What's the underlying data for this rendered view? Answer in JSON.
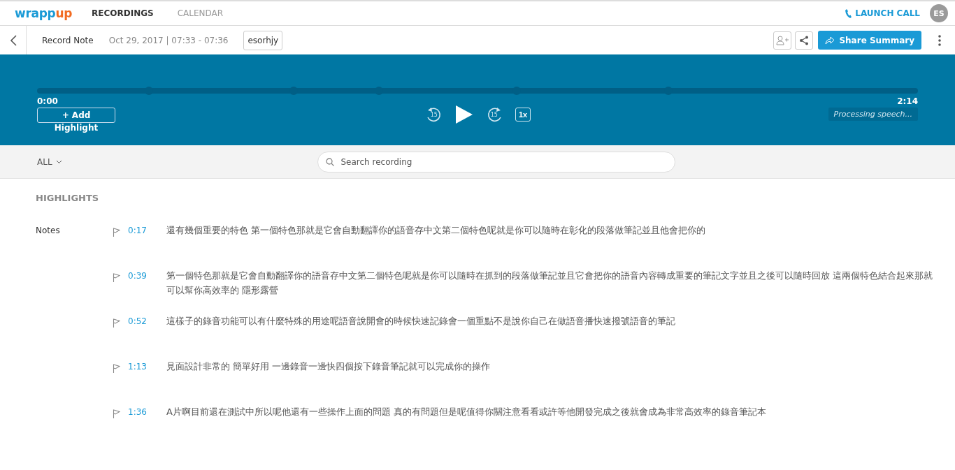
{
  "nav": {
    "logo_left": "wrapp",
    "logo_right": "up",
    "tabs": [
      {
        "label": "RECORDINGS",
        "selected": true
      },
      {
        "label": "CALENDAR",
        "selected": false
      }
    ],
    "launch_call": "LAUNCH CALL",
    "avatar": "ES"
  },
  "record": {
    "title": "Record Note",
    "datetime": "Oct 29, 2017 | 07:33 - 07:36",
    "tag": "esorhjy",
    "share_button": "Share Summary"
  },
  "player": {
    "start_time": "0:00",
    "end_time": "2:14",
    "add_button": "+ Add",
    "add_label": "Highlight",
    "skip_back": "15",
    "skip_forward": "15",
    "speed": "1x",
    "status": "Processing speech..."
  },
  "filter": {
    "dropdown": "ALL",
    "search_placeholder": "Search recording"
  },
  "highlights": {
    "heading": "HIGHLIGHTS",
    "group": "Notes",
    "items": [
      {
        "time": "0:17",
        "text": "還有幾個重要的特色 第一個特色那就是它會自動翻譯你的語音存中文第二個特色呢就是你可以隨時在彰化的段落做筆記並且他會把你的"
      },
      {
        "time": "0:39",
        "text": "第一個特色那就是它會自動翻譯你的語音存中文第二個特色呢就是你可以隨時在抓到的段落做筆記並且它會把你的語音內容轉成重要的筆記文字並且之後可以隨時回放 這兩個特色結合起來那就可以幫你高效率的 隱形露營"
      },
      {
        "time": "0:52",
        "text": "這樣子的錄音功能可以有什麼特殊的用途呢語音說開會的時候快速記錄會一個重點不是說你自己在做語音播快速撥號語音的筆記"
      },
      {
        "time": "1:13",
        "text": "見面設計非常的 簡單好用 一邊錄音一邊快四個按下錄音筆記就可以完成你的操作"
      },
      {
        "time": "1:36",
        "text": "A片啊目前還在測試中所以呢他還有一些操作上面的問題 真的有問題但是呢值得你關注意看看或許等他開發完成之後就會成為非常高效率的錄音筆記本"
      }
    ]
  }
}
